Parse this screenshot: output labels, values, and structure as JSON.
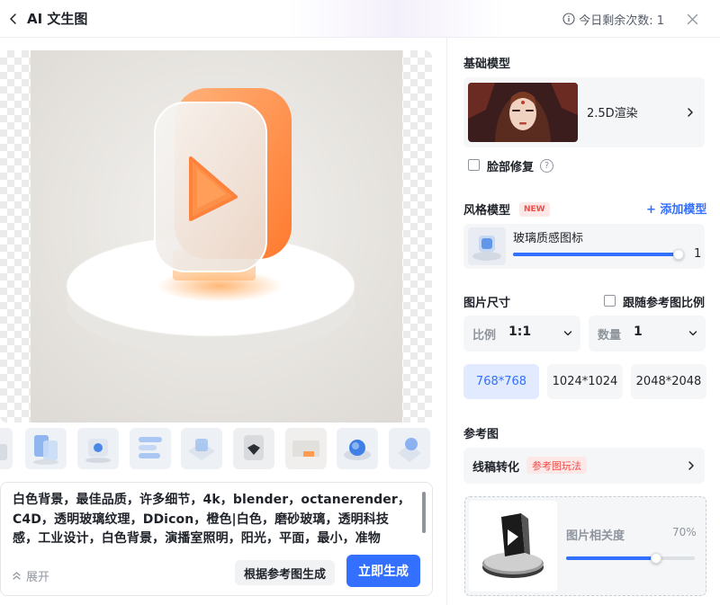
{
  "header": {
    "title": "AI 文生图",
    "quota_text": "今日剩余次数: 1"
  },
  "prompt": {
    "text": "白色背景，最佳品质，许多细节，4k，blender，octanerender，C4D，透明玻璃纹理，DDicon，橙色|白色，磨砂玻璃，透明科技感，工业设计，白色背景，演播室照明，阳光，平面，最小，准物",
    "expand_label": "展开",
    "ref_generate_label": "根据参考图生成",
    "generate_label": "立即生成"
  },
  "settings": {
    "base_model": {
      "title": "基础模型",
      "name": "2.5D渲染",
      "face_fix_label": "脸部修复",
      "face_fix_checked": false,
      "help_glyph": "?"
    },
    "style_model": {
      "title": "风格模型",
      "badge": "NEW",
      "add_label": "+ 添加模型",
      "item_name": "玻璃质感图标",
      "weight": 1,
      "weight_fraction": 0.98
    },
    "image_size": {
      "title": "图片尺寸",
      "follow_ref_label": "跟随参考图比例",
      "follow_ref_checked": false,
      "ratio_label": "比例",
      "ratio_value": "1:1",
      "count_label": "数量",
      "count_value": "1",
      "options": [
        "768*768",
        "1024*1024",
        "2048*2048"
      ],
      "selected": "768*768"
    },
    "reference": {
      "title": "参考图",
      "mode_label": "线稿转化",
      "mode_badge": "参考图玩法",
      "relevance_label": "图片相关度",
      "relevance_value": "70%",
      "relevance_fraction": 0.7
    }
  },
  "colors": {
    "accent": "#3370ff",
    "orange": "#ff8a3d",
    "badge_red": "#f54a45"
  }
}
